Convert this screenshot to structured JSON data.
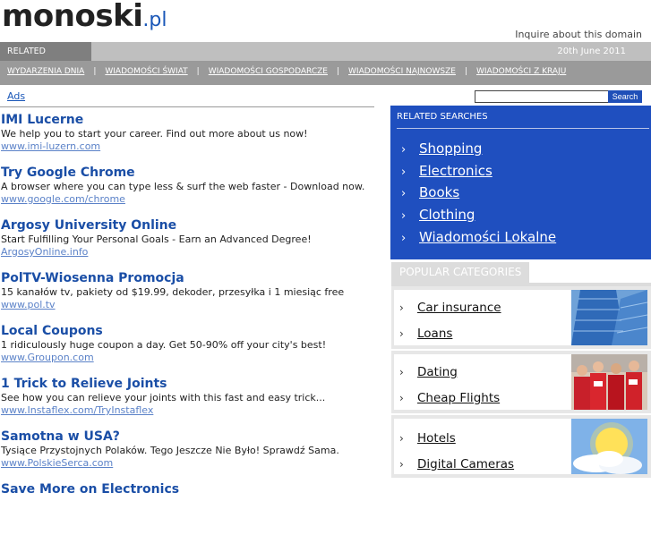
{
  "logo": {
    "name": "monoski",
    "tld": ".pl"
  },
  "header": {
    "inquire": "Inquire about this domain",
    "related_label": "RELATED SEARCHES",
    "date": "20th June 2011"
  },
  "nav": [
    "WYDARZENIA DNIA",
    "WIADOMOŚCI ŚWIAT",
    "WIADOMOŚCI GOSPODARCZE",
    "WIADOMOŚCI NAJNOWSZE",
    "WIADOMOŚCI Z KRAJU"
  ],
  "ads_label": "Ads",
  "search": {
    "button": "Search",
    "value": ""
  },
  "ads": [
    {
      "title": "IMI Lucerne",
      "desc": "We help you to start your career. Find out more about us now!",
      "url": "www.imi-luzern.com"
    },
    {
      "title": "Try Google Chrome",
      "desc": "A browser where you can type less & surf the web faster - Download now.",
      "url": "www.google.com/chrome"
    },
    {
      "title": "Argosy University Online",
      "desc": "Start Fulfilling Your Personal Goals - Earn an Advanced Degree!",
      "url": "ArgosyOnline.info"
    },
    {
      "title": "PolTV-Wiosenna Promocja",
      "desc": "15 kanałów tv, pakiety od $19.99, dekoder, przesyłka i 1 miesiąc free",
      "url": "www.pol.tv"
    },
    {
      "title": "Local Coupons",
      "desc": "1 ridiculously huge coupon a day. Get 50-90% off your city's best!",
      "url": "www.Groupon.com"
    },
    {
      "title": "1 Trick to Relieve Joints",
      "desc": "See how you can relieve your joints with this fast and easy trick...",
      "url": "www.Instaflex.com/TryInstaflex"
    },
    {
      "title": "Samotna w USA?",
      "desc": "Tysiące Przystojnych Polaków. Tego Jeszcze Nie Było! Sprawdź Sama.",
      "url": "www.PolskieSerca.com"
    },
    {
      "title": "Save More on Electronics",
      "desc": "",
      "url": ""
    }
  ],
  "related": {
    "title": "RELATED SEARCHES",
    "items": [
      "Shopping",
      "Electronics",
      "Books",
      "Clothing",
      "Wiadomości Lokalne"
    ]
  },
  "popular": {
    "title": "POPULAR CATEGORIES",
    "groups": [
      {
        "items": [
          "Car insurance",
          "Loans"
        ],
        "image": "skyscraper-image"
      },
      {
        "items": [
          "Dating",
          "Cheap Flights"
        ],
        "image": "crowd-image"
      },
      {
        "items": [
          "Hotels",
          "Digital Cameras"
        ],
        "image": "sun-cloud-image"
      }
    ]
  },
  "colors": {
    "accent_blue": "#1f4fbf",
    "link_blue": "#1a4ea6",
    "url_blue": "#5b82c8",
    "bar_gray": "#9a9a9a"
  }
}
